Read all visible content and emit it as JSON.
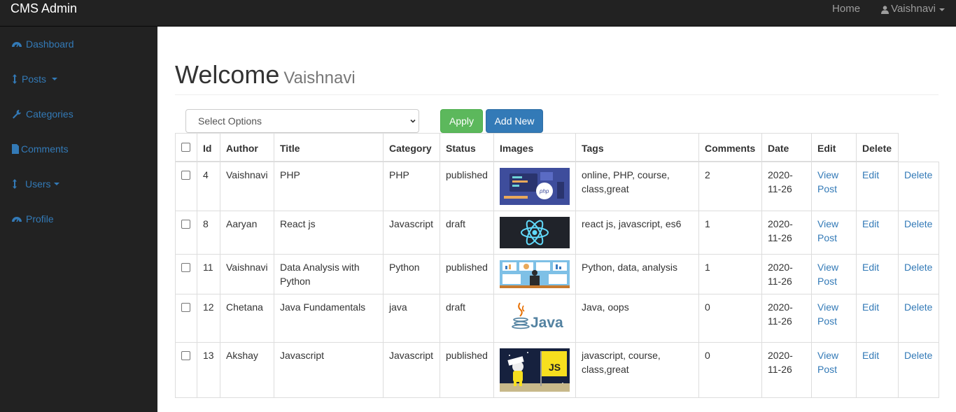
{
  "topbar": {
    "brand": "CMS Admin",
    "home_label": "Home",
    "user_label": "Vaishnavi"
  },
  "sidebar": {
    "items": [
      {
        "label": "Dashboard",
        "icon": "dashboard-icon"
      },
      {
        "label": "Posts",
        "icon": "vertical-arrows-icon"
      },
      {
        "label": "Categories",
        "icon": "wrench-icon"
      },
      {
        "label": "Comments",
        "icon": "file-icon"
      },
      {
        "label": "Users",
        "icon": "vertical-arrows-icon"
      },
      {
        "label": "Profile",
        "icon": "dashboard-icon"
      }
    ]
  },
  "main": {
    "title": "Welcome",
    "subtitle": "Vaishnavi",
    "select_value": "Select Options",
    "apply_label": "Apply",
    "add_new_label": "Add New"
  },
  "table": {
    "headers": [
      "Id",
      "Author",
      "Title",
      "Category",
      "Status",
      "Images",
      "Tags",
      "Comments",
      "Date",
      "Edit",
      "Delete"
    ],
    "rows": [
      {
        "id": "4",
        "author": "Vaishnavi",
        "title": "PHP",
        "category": "PHP",
        "status": "published",
        "image": "php-course-illustration",
        "tags": "online, PHP, course, class,great",
        "comments": "2",
        "date": "2020-11-26",
        "view": "View Post",
        "edit": "Edit",
        "delete": "Delete"
      },
      {
        "id": "8",
        "author": "Aaryan",
        "title": "React js",
        "category": "Javascript",
        "status": "draft",
        "image": "react-logo",
        "tags": "react js, javascript, es6",
        "comments": "1",
        "date": "2020-11-26",
        "view": "View Post",
        "edit": "Edit",
        "delete": "Delete"
      },
      {
        "id": "11",
        "author": "Vaishnavi",
        "title": "Data Analysis with Python",
        "category": "Python",
        "status": "published",
        "image": "data-analysis-illustration",
        "tags": "Python, data, analysis",
        "comments": "1",
        "date": "2020-11-26",
        "view": "View Post",
        "edit": "Edit",
        "delete": "Delete"
      },
      {
        "id": "12",
        "author": "Chetana",
        "title": "Java Fundamentals",
        "category": "java",
        "status": "draft",
        "image": "java-logo",
        "tags": "Java, oops",
        "comments": "0",
        "date": "2020-11-26",
        "view": "View Post",
        "edit": "Edit",
        "delete": "Delete"
      },
      {
        "id": "13",
        "author": "Akshay",
        "title": "Javascript",
        "category": "Javascript",
        "status": "published",
        "image": "javascript-astronaut-illustration",
        "tags": "javascript, course, class,great",
        "comments": "0",
        "date": "2020-11-26",
        "view": "View Post",
        "edit": "Edit",
        "delete": "Delete"
      }
    ]
  },
  "colors": {
    "navbar": "#222222",
    "link": "#337ab7",
    "apply": "#5cb85c",
    "add_new": "#337ab7"
  }
}
